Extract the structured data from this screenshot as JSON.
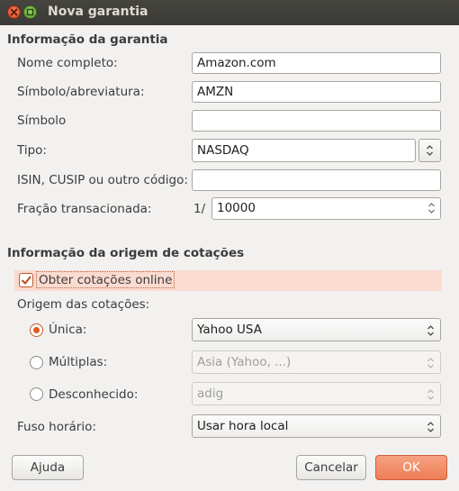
{
  "window": {
    "title": "Nova garantia"
  },
  "security_info": {
    "heading": "Informação da garantia",
    "name_label": "Nome completo:",
    "name_value": "Amazon.com",
    "abbrev_label": "Símbolo/abreviatura:",
    "abbrev_value": "AMZN",
    "symbol_label": "Símbolo",
    "symbol_value": "",
    "type_label": "Tipo:",
    "type_value": "NASDAQ",
    "code_label": "ISIN, CUSIP ou outro código:",
    "code_value": "",
    "fraction_label": "Fração transacionada:",
    "fraction_prefix": "1/",
    "fraction_value": "10000"
  },
  "quote_source": {
    "heading": "Informação da origem de cotações",
    "online_checkbox_label": "Obter cotações online",
    "online_checked": true,
    "origin_label": "Origem das cotações:",
    "single_label": "Única:",
    "single_value": "Yahoo USA",
    "multiple_label": "Múltiplas:",
    "multiple_value": "Asia (Yahoo, ...)",
    "unknown_label": "Desconhecido:",
    "unknown_value": "adig",
    "selected_source": "Única",
    "timezone_label": "Fuso horário:",
    "timezone_value": "Usar hora local"
  },
  "buttons": {
    "help": "Ajuda",
    "cancel": "Cancelar",
    "ok": "OK"
  },
  "colors": {
    "accent": "#ee7d55",
    "titlebar": "#3c3b37",
    "highlight_row": "#fbdad0"
  }
}
